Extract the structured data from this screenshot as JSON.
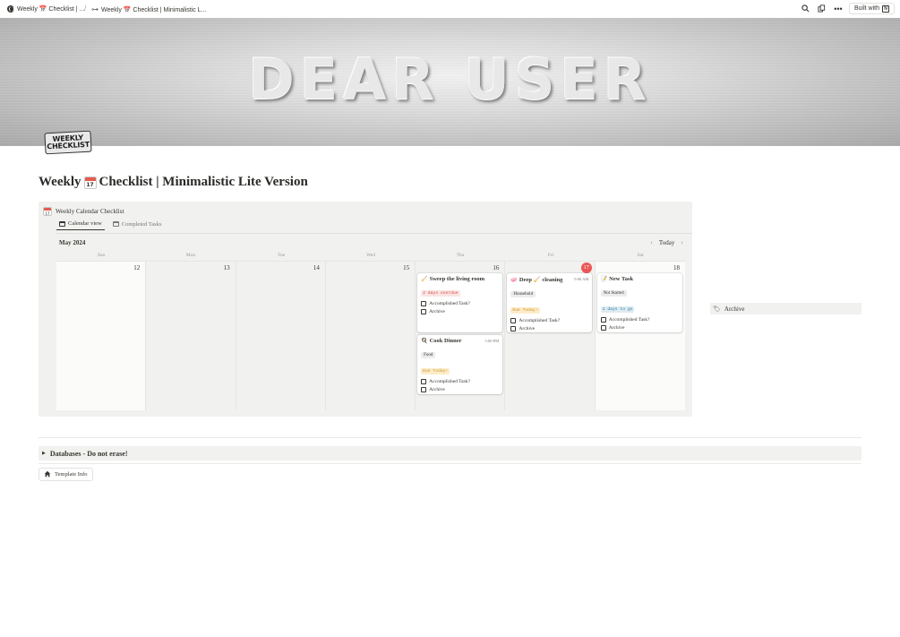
{
  "topbar": {
    "crumb1": "Weekly 📅 Checklist | ...",
    "separator": "/",
    "crumb2": "Weekly 📅 Checklist | Minimalistic L...",
    "built_with": "Built with",
    "icons": [
      "search-icon",
      "duplicate-icon",
      "more-icon",
      "notion-icon"
    ]
  },
  "cover": {
    "text": "DEAR USER"
  },
  "page_icon": {
    "line1": "WEEKLY",
    "line2": "CHECKLIST"
  },
  "page": {
    "title_part1": "Weekly",
    "title_cal_day": "17",
    "title_part2": "Checklist | Minimalistic Lite Version"
  },
  "calendar": {
    "name": "Weekly Calendar Checklist",
    "views": [
      {
        "label": "Calendar view",
        "active": true
      },
      {
        "label": "Completed Tasks",
        "active": false
      }
    ],
    "month": "May 2024",
    "today_label": "Today",
    "weekdays": [
      "Sun",
      "Mon",
      "Tue",
      "Wed",
      "Thu",
      "Fri",
      "Sat"
    ],
    "days": [
      "12",
      "13",
      "14",
      "15",
      "16",
      "17",
      "18"
    ],
    "today_index": 5
  },
  "cards": {
    "sweep": {
      "title": "Sweep the living room",
      "badge": "2 days overdue",
      "check1": "Accomplished Task?",
      "check2": "Archive"
    },
    "dinner": {
      "title": "Cook Dinner",
      "time": "5:00 PM",
      "tag": "Food",
      "badge": "Due Today!",
      "check1": "Accomplished Task?",
      "check2": "Archive"
    },
    "deep": {
      "title": "Deep 🧹 cleaning",
      "time": "9:00 AM",
      "tag": "Household",
      "badge": "Due Today!",
      "check1": "Accomplished Task?",
      "check2": "Archive"
    },
    "newtask": {
      "title": "New Task",
      "tag": "Not Started",
      "badge": "1 days to go",
      "check1": "Accomplished Task?",
      "check2": "Archive"
    }
  },
  "archive": {
    "label": "Archive"
  },
  "toggle": {
    "label": "Databases - Do not erase!"
  },
  "template_info": {
    "label": "Template Info"
  },
  "colors": {
    "overdue": "#d44c47",
    "due_today": "#cb912f",
    "upcoming": "#337ea9",
    "today_circle": "#eb5757"
  }
}
